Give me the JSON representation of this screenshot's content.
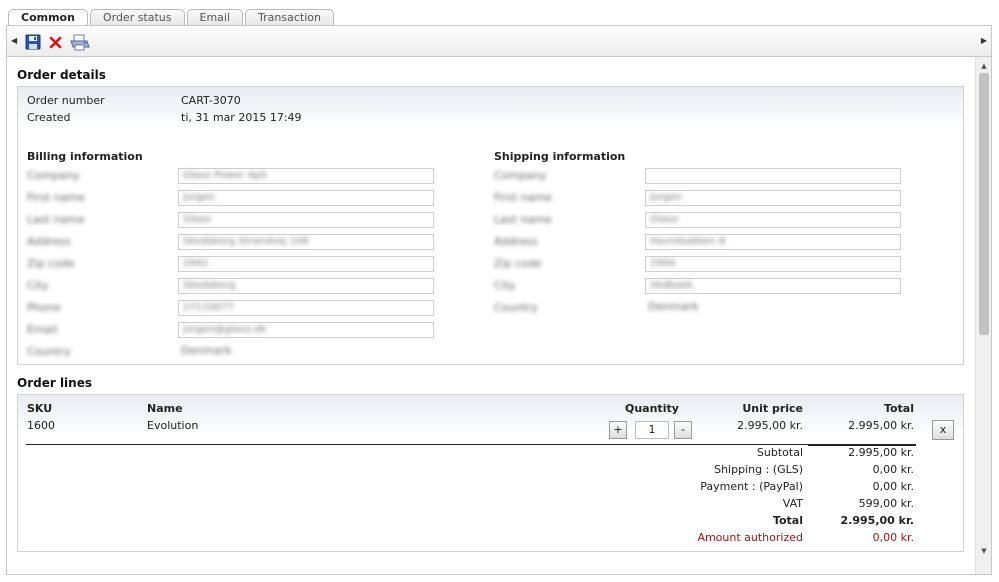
{
  "tabs": [
    {
      "label": "Common"
    },
    {
      "label": "Order status"
    },
    {
      "label": "Email"
    },
    {
      "label": "Transaction"
    }
  ],
  "order_details": {
    "title": "Order details",
    "order_number_label": "Order number",
    "order_number": "CART-3070",
    "created_label": "Created",
    "created": "ti, 31 mar 2015 17:49"
  },
  "billing": {
    "title": "Billing information",
    "fields": [
      {
        "label": "Company",
        "value": "Glaso Power ApS"
      },
      {
        "label": "First name",
        "value": "Jorgen"
      },
      {
        "label": "Last name",
        "value": "Glaso"
      },
      {
        "label": "Address",
        "value": "Skodsborg Strandvej 108"
      },
      {
        "label": "Zip code",
        "value": "2942"
      },
      {
        "label": "City",
        "value": "Skodsborg"
      },
      {
        "label": "Phone",
        "value": "27110077"
      },
      {
        "label": "Email",
        "value": "jorgen@glaso.dk"
      }
    ],
    "country_label": "Country",
    "country": "Denmark"
  },
  "shipping": {
    "title": "Shipping information",
    "fields": [
      {
        "label": "Company",
        "value": ""
      },
      {
        "label": "First name",
        "value": "Jorgen"
      },
      {
        "label": "Last name",
        "value": "Glaso"
      },
      {
        "label": "Address",
        "value": "Havrebakken 8"
      },
      {
        "label": "Zip code",
        "value": "2950"
      },
      {
        "label": "City",
        "value": "Vedbaek"
      }
    ],
    "country_label": "Country",
    "country": "Denmark"
  },
  "order_lines": {
    "title": "Order lines",
    "headers": {
      "sku": "SKU",
      "name": "Name",
      "quantity": "Quantity",
      "unit_price": "Unit price",
      "total": "Total"
    },
    "rows": [
      {
        "sku": "1600",
        "name": "Evolution",
        "quantity": "1",
        "unit_price": "2.995,00 kr.",
        "total": "2.995,00 kr.",
        "remove": "x"
      }
    ],
    "plus": "+",
    "minus": "-",
    "summary": {
      "subtotal_label": "Subtotal",
      "subtotal": "2.995,00 kr.",
      "shipping_label": "Shipping : (GLS)",
      "shipping": "0,00 kr.",
      "payment_label": "Payment : (PayPal)",
      "payment": "0,00 kr.",
      "vat_label": "VAT",
      "vat": "599,00 kr.",
      "total_label": "Total",
      "total": "2.995,00 kr.",
      "authorized_label": "Amount authorized",
      "authorized": "0,00 kr."
    }
  },
  "colors": {
    "authorized": "#8b1a1a",
    "panel_top": "#e9ebf1"
  },
  "icons": {
    "save": "save-disk-icon",
    "cancel": "delete-x-icon",
    "print": "print-icon"
  }
}
